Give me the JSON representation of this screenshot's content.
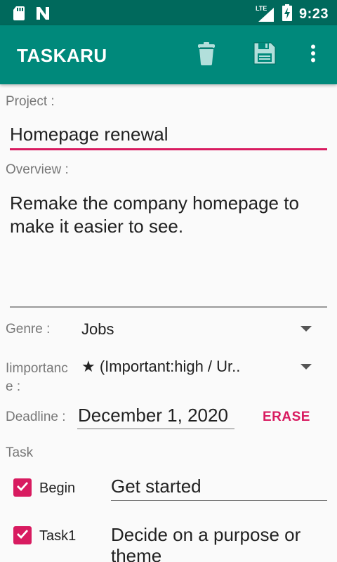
{
  "status_bar": {
    "time": "9:23",
    "network": "LTE"
  },
  "app_bar": {
    "title": "TASKARU",
    "icons": [
      "trash-icon",
      "save-icon",
      "more-vert-icon"
    ]
  },
  "form": {
    "project_label": "Project :",
    "project_value": "Homepage renewal",
    "overview_label": "Overview :",
    "overview_value": "Remake the company homepage to make it easier to see.",
    "genre_label": "Genre :",
    "genre_value": "Jobs",
    "importance_label": "Iimportance :",
    "importance_value": "★ (Important:high / Ur..",
    "deadline_label": "Deadline :",
    "deadline_value": "December 1, 2020",
    "erase_label": "ERASE",
    "task_label": "Task"
  },
  "tasks": [
    {
      "name": "Begin",
      "description": "Get started",
      "checked": true
    },
    {
      "name": "Task1",
      "description": "Decide on a purpose or theme",
      "checked": true
    }
  ],
  "colors": {
    "status_bar": "#00695c",
    "app_bar": "#00897b",
    "accent": "#d81b60"
  }
}
